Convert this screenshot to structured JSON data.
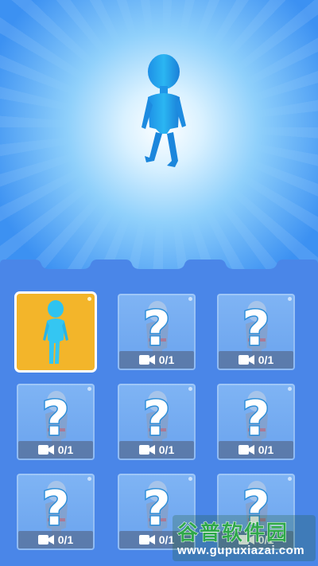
{
  "skins": [
    {
      "selected": true,
      "locked": false,
      "progress": ""
    },
    {
      "selected": false,
      "locked": true,
      "progress": "0/1"
    },
    {
      "selected": false,
      "locked": true,
      "progress": "0/1"
    },
    {
      "selected": false,
      "locked": true,
      "progress": "0/1"
    },
    {
      "selected": false,
      "locked": true,
      "progress": "0/1"
    },
    {
      "selected": false,
      "locked": true,
      "progress": "0/1"
    },
    {
      "selected": false,
      "locked": true,
      "progress": "0/1"
    },
    {
      "selected": false,
      "locked": true,
      "progress": "0/1"
    },
    {
      "selected": false,
      "locked": true,
      "progress": "0/1"
    }
  ],
  "locked_symbol": "?",
  "unlock_icon": "video-camera-icon",
  "watermark": {
    "title": "谷普软件园",
    "url": "www.gupuxiazai.com"
  },
  "colors": {
    "background": "#3d8ff0",
    "panel": "#4a86e8",
    "selected_card": "#f3b52a",
    "character": "#26b4ee"
  }
}
